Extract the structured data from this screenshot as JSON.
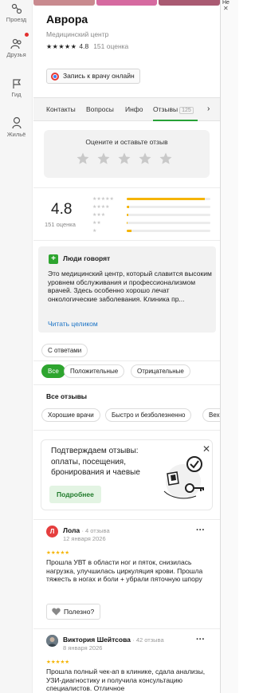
{
  "rail": {
    "items": [
      {
        "label": "Проезд",
        "icon": "route-icon"
      },
      {
        "label": "Друзья",
        "icon": "friends-icon"
      },
      {
        "label": "Гид",
        "icon": "guide-flag-icon"
      },
      {
        "label": "Жильё",
        "icon": "housing-icon"
      }
    ]
  },
  "right_strip": {
    "label": "Не"
  },
  "org": {
    "name": "Аврора",
    "category": "Медицинский центр",
    "rating": "4.8",
    "reviews_count": "151 оценка",
    "book_button": "Запись к врачу онлайн"
  },
  "tabs": [
    {
      "label": "Контакты"
    },
    {
      "label": "Вопросы"
    },
    {
      "label": "Инфо"
    },
    {
      "label": "Отзывы",
      "badge": "125",
      "active": true
    }
  ],
  "rate_prompt": "Оцените и оставьте отзыв",
  "summary": {
    "score": "4.8",
    "count": "151 оценка",
    "distribution": [
      {
        "stars": 5,
        "fraction": 0.93
      },
      {
        "stars": 4,
        "fraction": 0.03
      },
      {
        "stars": 3,
        "fraction": 0.02
      },
      {
        "stars": 2,
        "fraction": 0.01
      },
      {
        "stars": 1,
        "fraction": 0.06
      }
    ]
  },
  "people_say": {
    "title": "Люди говорят",
    "text": "Это медицинский центр, который славится высоким уровнем обслуживания и профессионализмом врачей. Здесь особенно хорошо лечат онкологические заболевания. Клиника пр...",
    "read_more": "Читать целиком"
  },
  "filters": {
    "with_answers": "С ответами",
    "all": "Все",
    "positive": "Положительные",
    "negative": "Отрицательные"
  },
  "all_reviews_title": "Все отзывы",
  "topics": [
    "Хорошие врачи",
    "Быстро и безболезненно",
    "Вех"
  ],
  "promo": {
    "text": "Подтверждаем отзывы: оплаты, посещения, бронирования и чаевые",
    "button": "Подробнее"
  },
  "reviews": [
    {
      "avatar_letter": "Л",
      "author": "Лола",
      "meta": "· 4 отзыва",
      "date": "12 января 2026",
      "stars": 5,
      "text": "Прошла УВТ в области ног и пяток, снизилась нагрузка, улучшилась циркуляция крови. Прошла тяжесть в ногах и боли + убрали пяточную шпору",
      "useful": "Полезно?"
    },
    {
      "author": "Виктория Шейтсова",
      "meta": "· 42 отзыва",
      "date": "8 января 2026",
      "stars": 5,
      "text": "Прошла полный чек-ап в клинике, сдала анализы, УЗИ-диагностику и получила консультацию специалистов. Отличное"
    }
  ],
  "colors": {
    "accent_green": "#2ea52f",
    "star_yellow": "#f5b400",
    "link_blue": "#1a73c6"
  }
}
